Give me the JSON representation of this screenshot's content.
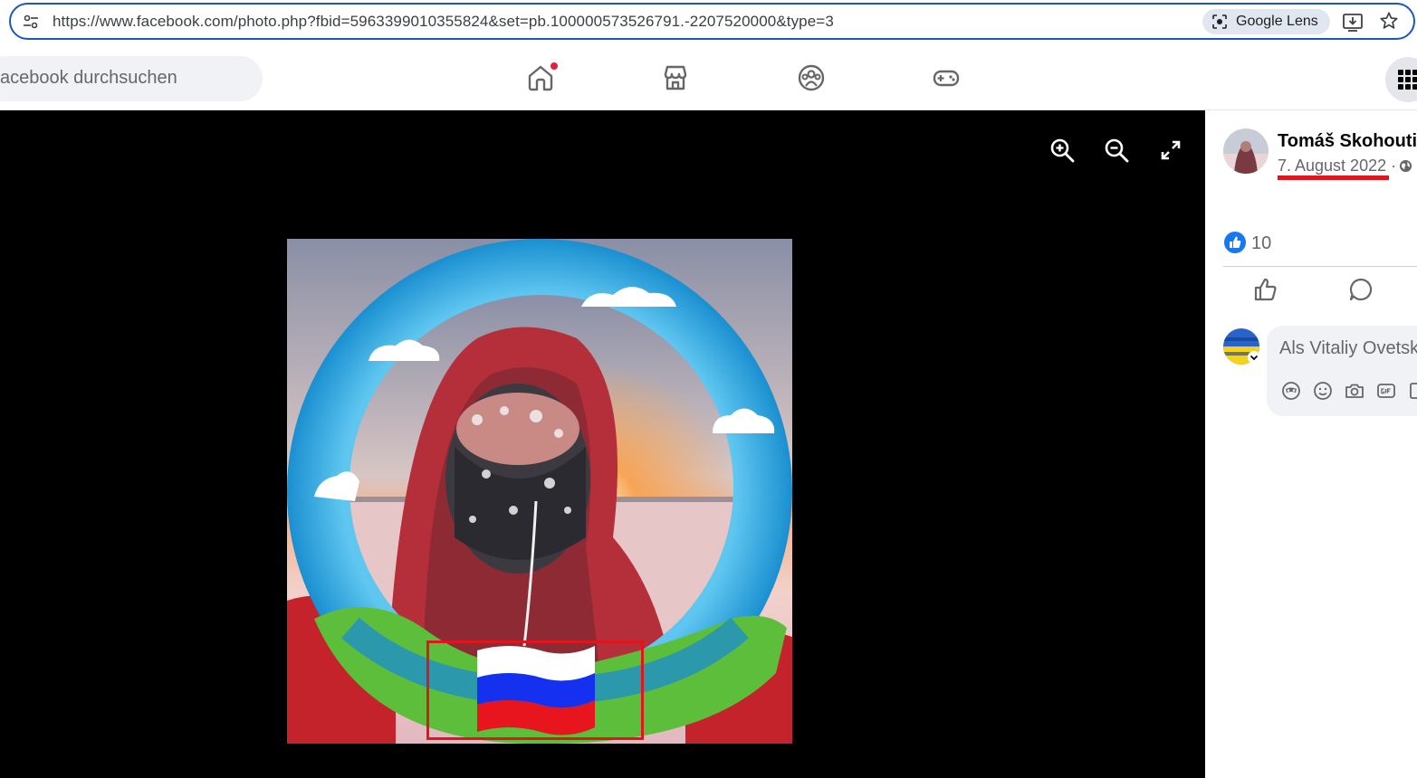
{
  "browser": {
    "url": "https://www.facebook.com/photo.php?fbid=5963399010355824&set=pb.100000573526791.-2207520000&type=3",
    "lens_label": "Google Lens",
    "focus_color": "#1a57c2"
  },
  "fb_nav": {
    "search_placeholder": "acebook durchsuchen",
    "icons": [
      "home-icon",
      "marketplace-icon",
      "groups-icon",
      "gaming-icon",
      "menu-grid-icon"
    ],
    "home_notification": true
  },
  "viewer": {
    "tools": [
      "zoom-in-icon",
      "zoom-out-icon",
      "fullscreen-icon"
    ],
    "photo_overlay": "russian-flag",
    "highlight_color": "#e0151e"
  },
  "post": {
    "author": "Tomáš Skohoutil",
    "date": "7. August 2022",
    "date_separator": "·",
    "privacy_icon": "globe-icon",
    "like_count": "10"
  },
  "comment": {
    "placeholder": "Als Vitaliy Ovetsky",
    "tools": [
      "avatar-sticker-icon",
      "emoji-icon",
      "camera-icon",
      "gif-icon",
      "sticker-icon"
    ]
  }
}
